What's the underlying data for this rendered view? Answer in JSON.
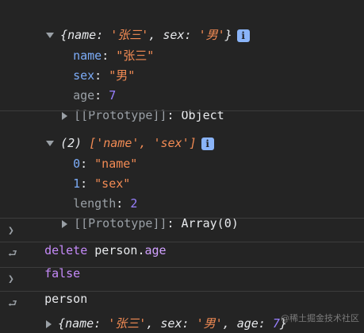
{
  "log_object": {
    "summary_open": "{",
    "summary_name_key": "name",
    "summary_name_val": "'张三'",
    "summary_sex_key": "sex",
    "summary_sex_val": "'男'",
    "summary_close": "}",
    "info_badge": "i",
    "props": [
      {
        "key": "name",
        "value": "\"张三\""
      },
      {
        "key": "sex",
        "value": "\"男\""
      },
      {
        "key": "age",
        "value": "7"
      }
    ],
    "prototype_label": "[[Prototype]]",
    "prototype_value": "Object"
  },
  "log_array": {
    "summary_count": "(2)",
    "summary_items": "['name', 'sex']",
    "info_badge": "i",
    "items": [
      {
        "index": "0",
        "value": "\"name\""
      },
      {
        "index": "1",
        "value": "\"sex\""
      }
    ],
    "length_key": "length",
    "length_value": "2",
    "prototype_label": "[[Prototype]]",
    "prototype_value": "Array(0)"
  },
  "commands": [
    {
      "input_keyword": "delete",
      "input_object": "person",
      "input_prop": "age",
      "result": "false"
    },
    {
      "input_text": "person"
    }
  ],
  "final_result": {
    "name_key": "name",
    "name_val": "'张三'",
    "sex_key": "sex",
    "sex_val": "'男'",
    "age_key": "age",
    "age_val": "7"
  },
  "icons": {
    "expand_open": "triangle-down-icon",
    "expand_closed": "triangle-right-icon",
    "input_prompt": "chevron-right-icon",
    "result_return": "return-arrow-icon"
  },
  "colors": {
    "background": "#242424",
    "string": "#f28b54",
    "key": "#7cacf8",
    "number": "#9980ff",
    "keyword": "#c58af9"
  },
  "watermark": "@稀土掘金技术社区"
}
